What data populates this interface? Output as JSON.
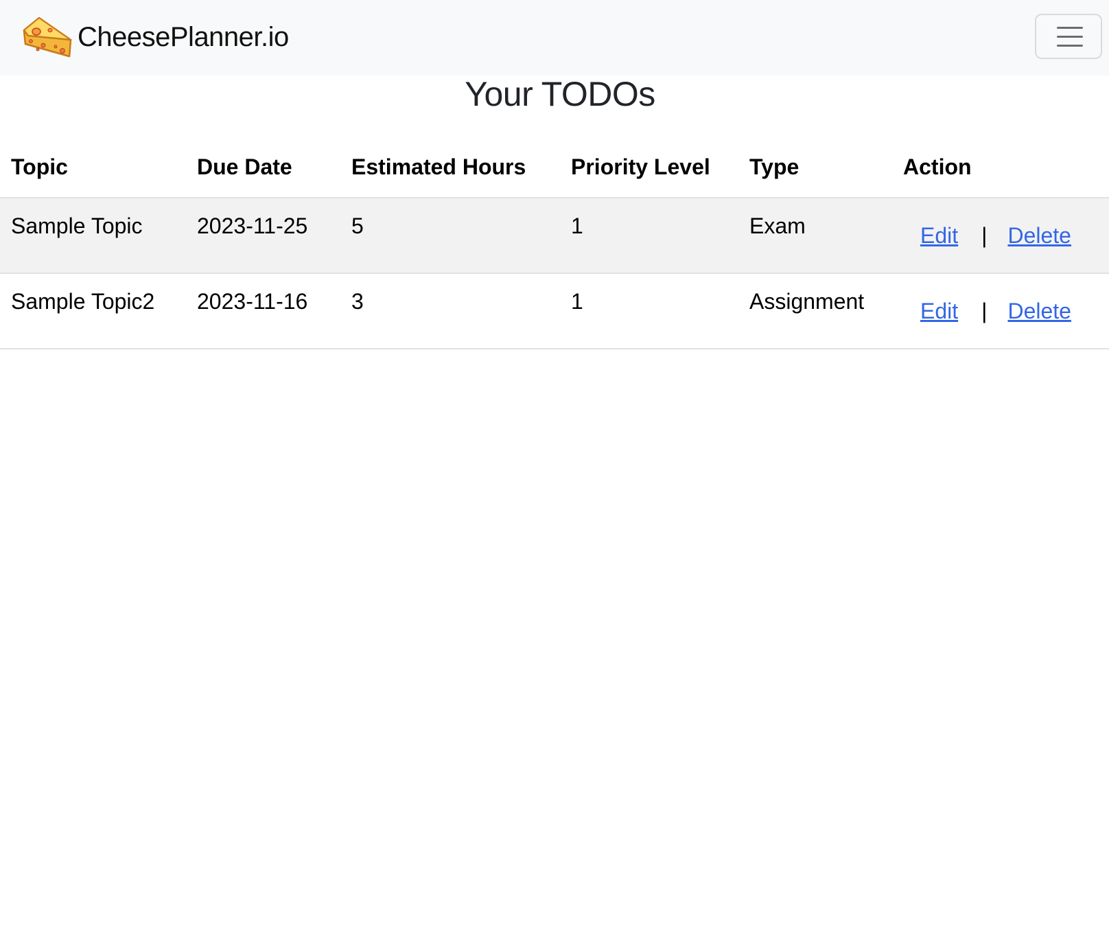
{
  "navbar": {
    "brand_name": "CheesePlanner.io",
    "logo_icon": "cheese-icon",
    "toggle_icon": "hamburger-menu-icon"
  },
  "page": {
    "title": "Your TODOs"
  },
  "table": {
    "headers": [
      "Topic",
      "Due Date",
      "Estimated Hours",
      "Priority Level",
      "Type",
      "Action"
    ],
    "rows": [
      {
        "topic": "Sample Topic",
        "due_date": "2023-11-25",
        "hours": "5",
        "priority": "1",
        "type": "Exam",
        "edit": "Edit",
        "separator": "|",
        "delete": "Delete"
      },
      {
        "topic": "Sample Topic2",
        "due_date": "2023-11-16",
        "hours": "3",
        "priority": "1",
        "type": "Assignment",
        "edit": "Edit",
        "separator": "|",
        "delete": "Delete"
      }
    ]
  },
  "colors": {
    "navbar_bg": "#f8f9fa",
    "link": "#3366e6",
    "striped_row": "#f2f2f2",
    "border": "#dee2e6"
  }
}
